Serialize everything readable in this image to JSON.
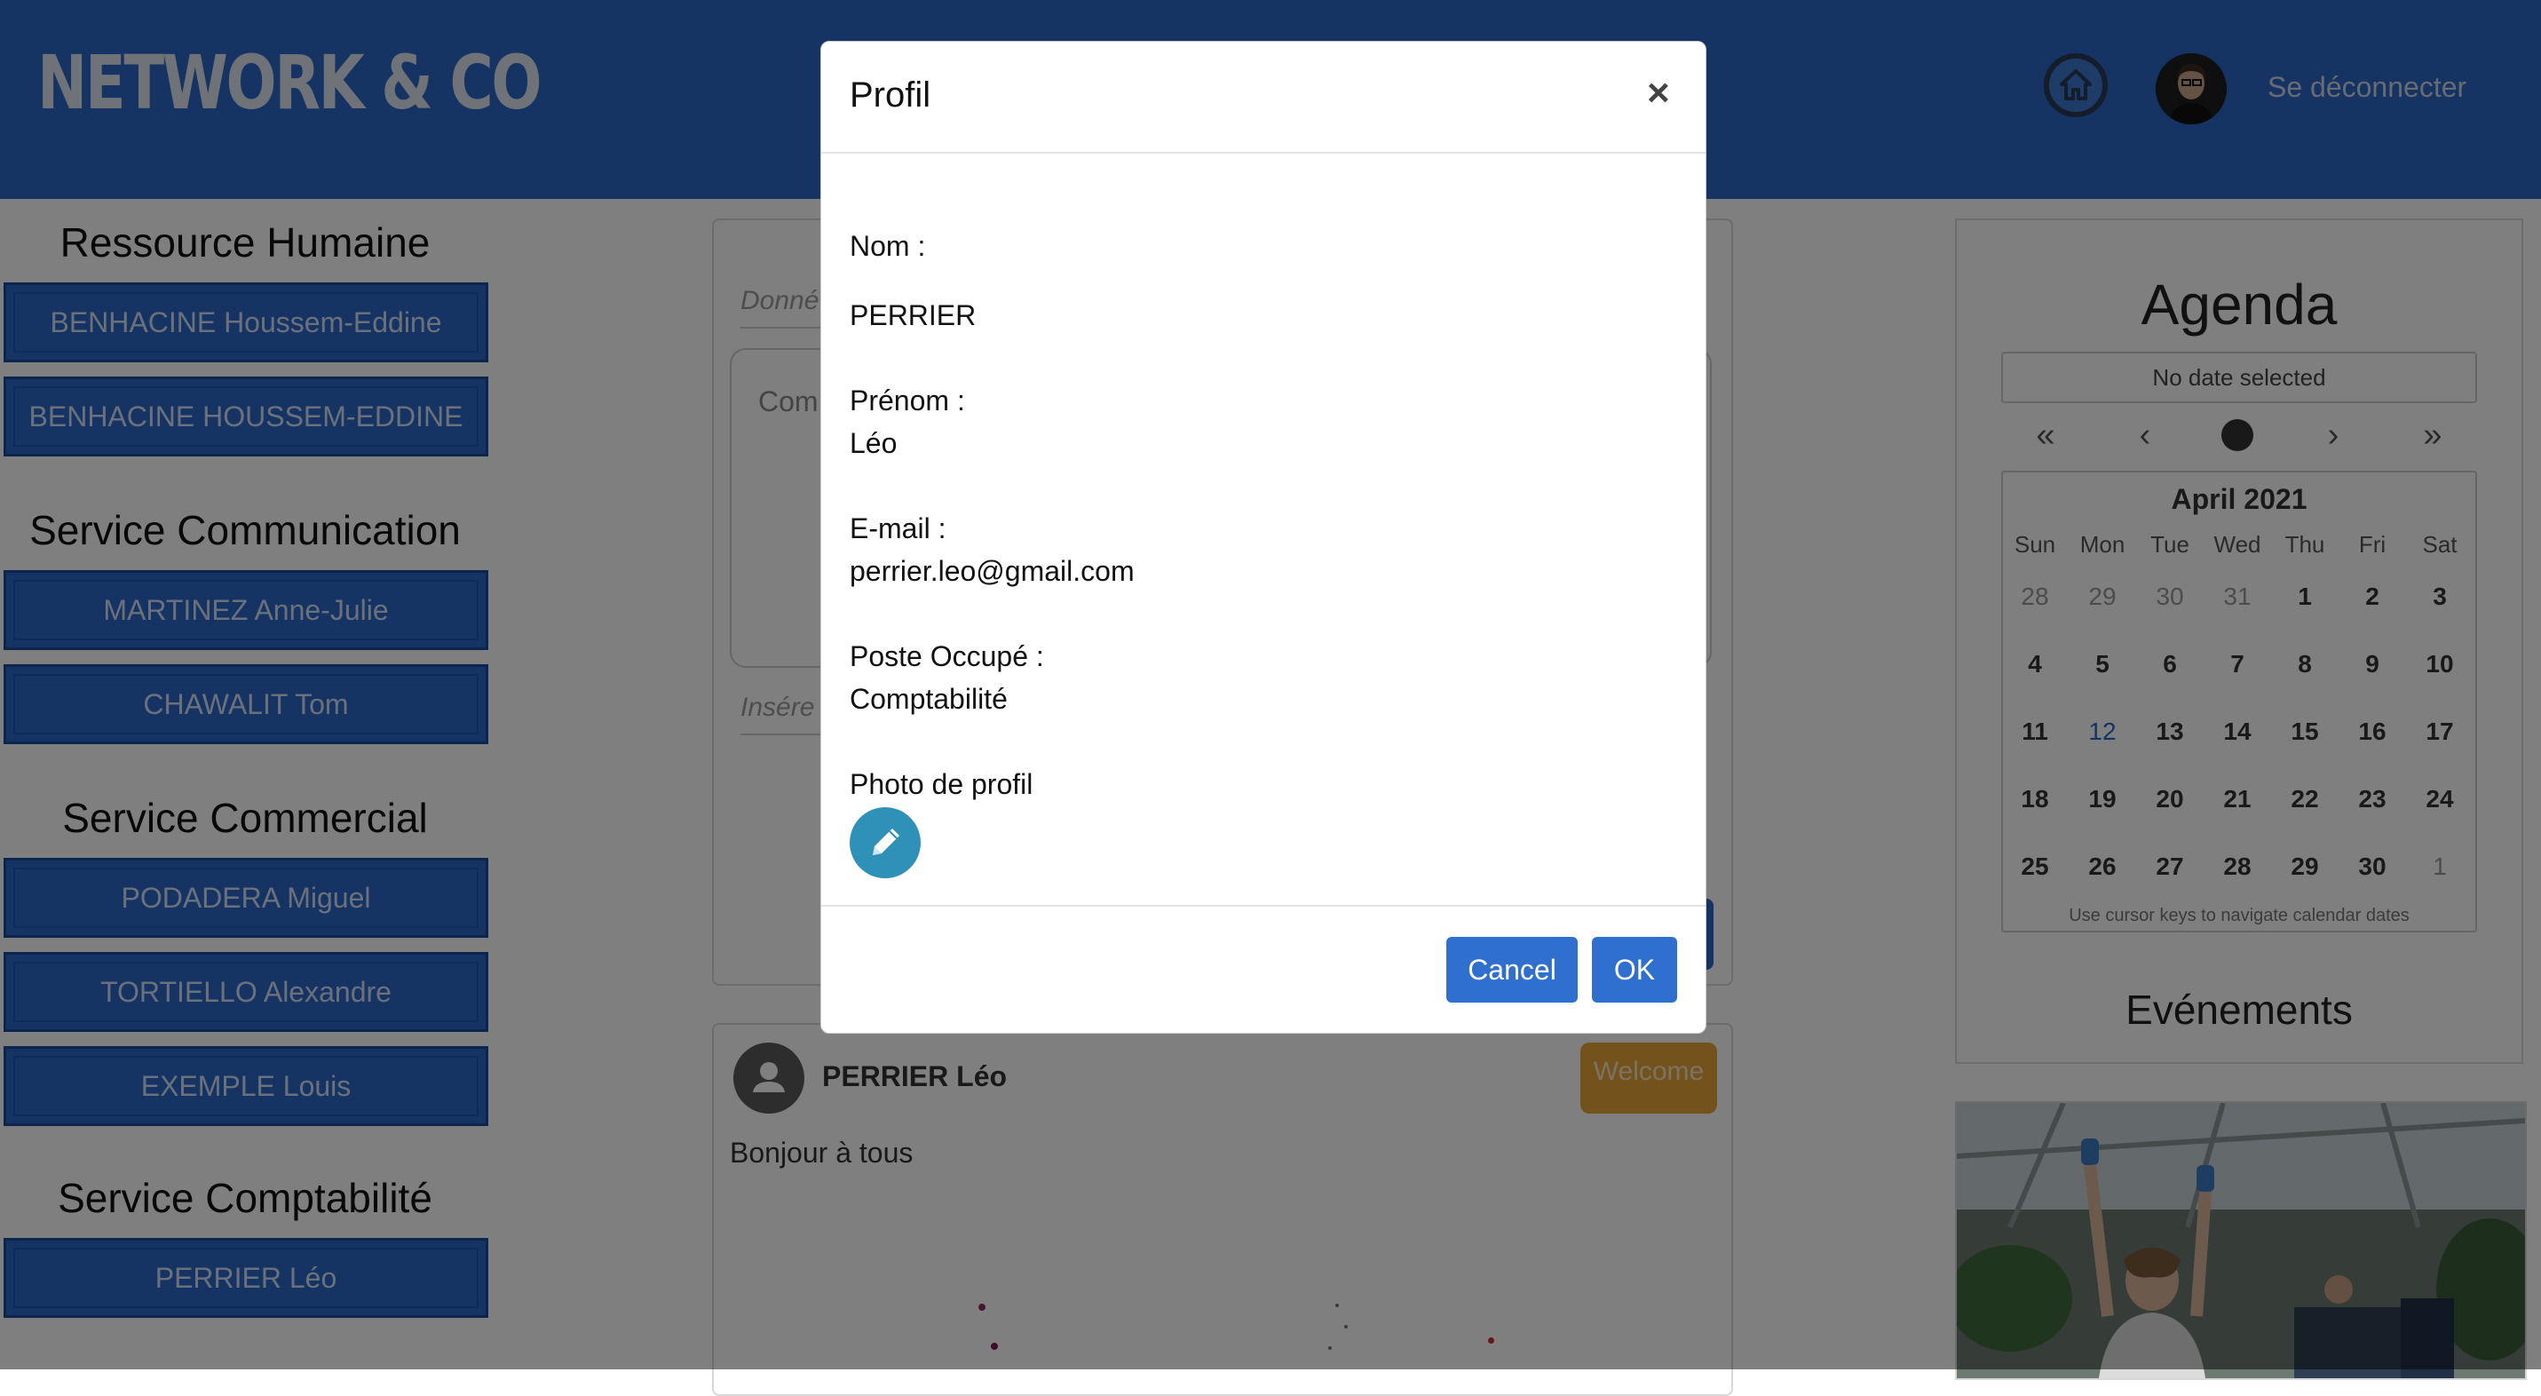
{
  "header": {
    "brand": "NETWORK & CO",
    "logout_label": "Se déconnecter"
  },
  "sidebar": {
    "sections": [
      {
        "title": "Ressource Humaine",
        "people": [
          "BENHACINE Houssem-Eddine",
          "BENHACINE HOUSSEM-EDDINE"
        ]
      },
      {
        "title": "Service Communication",
        "people": [
          "MARTINEZ Anne-Julie",
          "CHAWALIT Tom"
        ]
      },
      {
        "title": "Service Commercial",
        "people": [
          "PODADERA Miguel",
          "TORTIELLO Alexandre",
          "EXEMPLE Louis"
        ]
      },
      {
        "title": "Service Comptabilité",
        "people": [
          "PERRIER Léo"
        ]
      }
    ]
  },
  "composer": {
    "title_placeholder_partial": "Donné",
    "comment_placeholder_partial": "Com",
    "insert_placeholder_partial": "Insére"
  },
  "post": {
    "author": "PERRIER Léo",
    "badge": "Welcome",
    "text": "Bonjour à tous"
  },
  "agenda": {
    "title": "Agenda",
    "selected_text": "No date selected",
    "month_label": "April 2021",
    "weekdays": [
      "Sun",
      "Mon",
      "Tue",
      "Wed",
      "Thu",
      "Fri",
      "Sat"
    ],
    "weeks": [
      [
        "28",
        "29",
        "30",
        "31",
        "1",
        "2",
        "3"
      ],
      [
        "4",
        "5",
        "6",
        "7",
        "8",
        "9",
        "10"
      ],
      [
        "11",
        "12",
        "13",
        "14",
        "15",
        "16",
        "17"
      ],
      [
        "18",
        "19",
        "20",
        "21",
        "22",
        "23",
        "24"
      ],
      [
        "25",
        "26",
        "27",
        "28",
        "29",
        "30",
        "1"
      ]
    ],
    "today": "12",
    "hint": "Use cursor keys to navigate calendar dates",
    "events_title": "Evénements"
  },
  "modal": {
    "title": "Profil",
    "close_symbol": "×",
    "nom_label": "Nom :",
    "nom_value": "PERRIER",
    "prenom_label": "Prénom :",
    "prenom_value": "Léo",
    "email_label": "E-mail :",
    "email_value": "perrier.leo@gmail.com",
    "poste_label": "Poste Occupé :",
    "poste_value": "Comptabilité",
    "photo_label": "Photo de profil",
    "cancel_label": "Cancel",
    "ok_label": "OK"
  },
  "colors": {
    "header_blue": "#2a66c6",
    "button_blue": "#2f6fd0",
    "badge_gold": "#e6a437",
    "edit_teal": "#2f90b8"
  },
  "icons": [
    "home-icon",
    "pencil-icon",
    "close-icon",
    "double-chevron-left-icon",
    "chevron-left-icon",
    "chevron-right-icon",
    "double-chevron-right-icon",
    "user-icon"
  ]
}
